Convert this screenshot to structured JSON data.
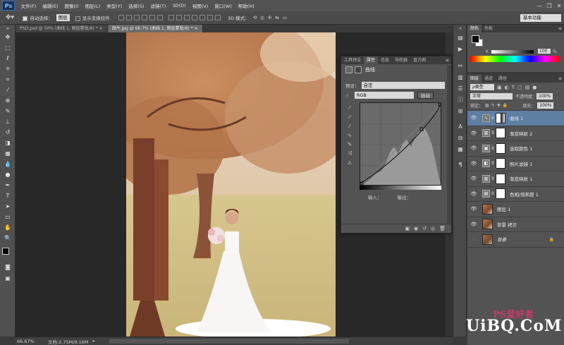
{
  "app": {
    "logo": "Ps"
  },
  "menu": [
    "文件(F)",
    "编辑(E)",
    "图像(I)",
    "图层(L)",
    "类型(Y)",
    "选择(S)",
    "滤镜(T)",
    "3D(D)",
    "视图(V)",
    "窗口(W)",
    "帮助(H)"
  ],
  "window_controls": [
    "—",
    "❐",
    "✕"
  ],
  "options": {
    "auto_select_label": "自动选择：",
    "auto_select_value": "图层",
    "show_transform_label": "显示变换控件",
    "mode_3d_label": "3D 模式：",
    "workspace": "基本功能"
  },
  "tabs": [
    {
      "label": "PSD.psd @ 50% (曲线 1, 图层蒙版/8) *",
      "close": "×"
    },
    {
      "label": "原片.jpg @ 66.7% (曲线 1, 图层蒙版/8) *",
      "close": "×"
    }
  ],
  "status": {
    "zoom": "66.67%",
    "doc": "文档:2.75M/9.16M"
  },
  "properties": {
    "tabs": [
      "工具预设",
      "属性",
      "信息",
      "导航器",
      "直方图"
    ],
    "title": "曲线",
    "preset_label": "预设：",
    "preset_value": "自定",
    "channel_value": "RGB",
    "auto_button": "自动",
    "input_label": "输入：",
    "output_label": "输出："
  },
  "color_panel": {
    "tabs": [
      "颜色",
      "色板"
    ],
    "k_label": "K",
    "k_value": "100",
    "k_unit": "%"
  },
  "layers_panel": {
    "tabs": [
      "图层",
      "通道",
      "路径"
    ],
    "kind_label": "ρ类型",
    "blend_mode": "正常",
    "opacity_label": "不透明度：",
    "opacity_value": "100%",
    "lock_label": "锁定：",
    "fill_label": "填充：",
    "fill_value": "100%",
    "layers": [
      {
        "name": "曲线 1",
        "type": "adjustment",
        "selected": true,
        "visible": true
      },
      {
        "name": "渐变映射 2",
        "type": "adjustment",
        "selected": false,
        "visible": true
      },
      {
        "name": "选取颜色 1",
        "type": "adjustment",
        "selected": false,
        "visible": true
      },
      {
        "name": "照片滤镜 1",
        "type": "adjustment",
        "selected": false,
        "visible": true
      },
      {
        "name": "渐变映射 1",
        "type": "adjustment",
        "selected": false,
        "visible": true
      },
      {
        "name": "色相/饱和度 1",
        "type": "adjustment",
        "selected": false,
        "visible": true
      },
      {
        "name": "图层 1",
        "type": "pixel",
        "selected": false,
        "visible": true
      },
      {
        "name": "背景 拷贝",
        "type": "pixel",
        "selected": false,
        "visible": true
      },
      {
        "name": "背景",
        "type": "background",
        "selected": false,
        "visible": false
      }
    ]
  },
  "watermark": {
    "line1": "PS爱好者",
    "line2": "UiBQ.CoM"
  },
  "icons": {
    "eye": "eye-icon",
    "lock": "lock-icon",
    "chain": "chain-icon"
  }
}
